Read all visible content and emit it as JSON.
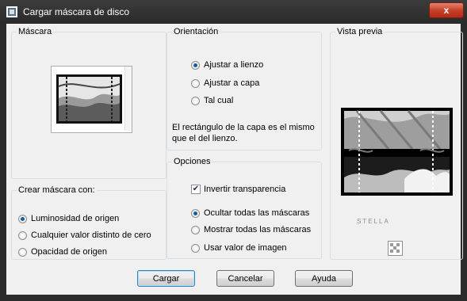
{
  "window": {
    "title": "Cargar máscara de disco",
    "close_glyph": "x"
  },
  "mascara": {
    "legend": "Máscara"
  },
  "orientacion": {
    "legend": "Orientación",
    "options": [
      "Ajustar a lienzo",
      "Ajustar a capa",
      "Tal cual"
    ],
    "selected_index": 0,
    "note": "El rectángulo de la capa es el mismo que el del lienzo."
  },
  "opciones": {
    "legend": "Opciones",
    "invert_label": "Invertir transparencia",
    "invert_checked": true,
    "options": [
      "Ocultar todas las máscaras",
      "Mostrar todas las máscaras",
      "Usar valor de imagen"
    ],
    "selected_index": 0
  },
  "crear": {
    "legend": "Crear máscara con:",
    "options": [
      "Luminosidad de origen",
      "Cualquier valor distinto de cero",
      "Opacidad de origen"
    ],
    "selected_index": 0
  },
  "preview": {
    "legend": "Vista previa",
    "watermark": "STELLA"
  },
  "buttons": {
    "ok": "Cargar",
    "cancel": "Cancelar",
    "help": "Ayuda"
  }
}
